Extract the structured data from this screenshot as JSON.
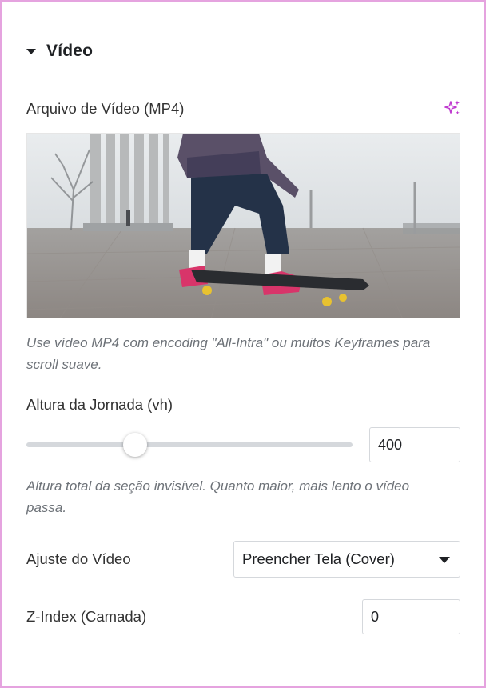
{
  "section": {
    "title": "Vídeo"
  },
  "video_file": {
    "label": "Arquivo de Vídeo (MP4)",
    "ai_icon": "sparkles-icon",
    "thumbnail": "skateboard-video-thumbnail",
    "help": "Use vídeo MP4 com encoding \"All-Intra\" ou muitos Keyframes para scroll suave."
  },
  "journey_height": {
    "label": "Altura da Jornada (vh)",
    "value": "400",
    "slider_fraction": 0.33,
    "help": "Altura total da seção invisível. Quanto maior, mais lento o vídeo passa."
  },
  "video_fit": {
    "label": "Ajuste do Vídeo",
    "selected": "Preencher Tela (Cover)"
  },
  "z_index": {
    "label": "Z-Index (Camada)",
    "value": "0"
  },
  "colors": {
    "frame_border": "#e5a3df",
    "ai_accent": "#c03bd0",
    "help_text": "#6d7278"
  }
}
